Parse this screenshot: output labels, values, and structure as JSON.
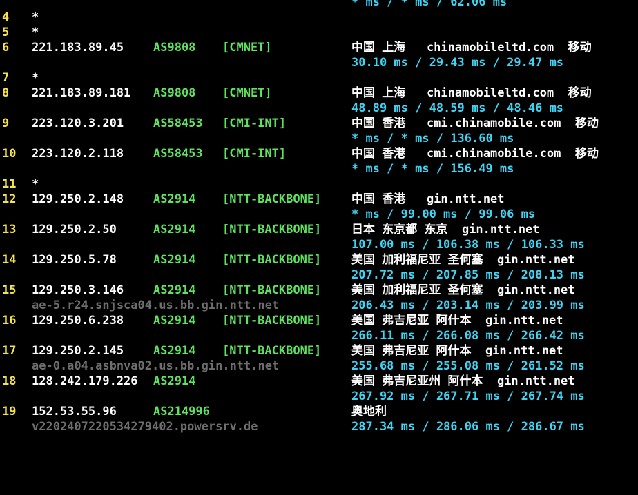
{
  "theme": {
    "background": "#000000",
    "hop_color": "#f4e34a",
    "ip_color": "#ffffff",
    "asn_color": "#5ee35e",
    "latency_color": "#3fd4f4",
    "rdns_color": "#6e6e6e"
  },
  "lines": [
    {
      "rtt": "* ms / * ms / 62.06 ms"
    },
    {
      "hop": "4",
      "star": "*"
    },
    {
      "hop": "5",
      "star": "*"
    },
    {
      "hop": "6",
      "ip": "221.183.89.45",
      "asn": "AS9808",
      "tag": "[CMNET]",
      "geo": "中国 上海   chinamobileltd.com  移动"
    },
    {
      "rtt": "30.10 ms / 29.43 ms / 29.47 ms"
    },
    {
      "hop": "7",
      "star": "*"
    },
    {
      "hop": "8",
      "ip": "221.183.89.181",
      "asn": "AS9808",
      "tag": "[CMNET]",
      "geo": "中国 上海   chinamobileltd.com  移动"
    },
    {
      "rtt": "48.89 ms / 48.59 ms / 48.46 ms"
    },
    {
      "hop": "9",
      "ip": "223.120.3.201",
      "asn": "AS58453",
      "tag": "[CMI-INT]",
      "geo": "中国 香港   cmi.chinamobile.com  移动"
    },
    {
      "rtt": "* ms / * ms / 136.60 ms"
    },
    {
      "hop": "10",
      "ip": "223.120.2.118",
      "asn": "AS58453",
      "tag": "[CMI-INT]",
      "geo": "中国 香港   cmi.chinamobile.com  移动"
    },
    {
      "rtt": "* ms / * ms / 156.49 ms"
    },
    {
      "hop": "11",
      "star": "*"
    },
    {
      "hop": "12",
      "ip": "129.250.2.148",
      "asn": "AS2914",
      "tag": "[NTT-BACKBONE]",
      "geo": "中国 香港   gin.ntt.net"
    },
    {
      "rtt": "* ms / 99.00 ms / 99.06 ms"
    },
    {
      "hop": "13",
      "ip": "129.250.2.50",
      "asn": "AS2914",
      "tag": "[NTT-BACKBONE]",
      "geo": "日本 东京都 东京  gin.ntt.net"
    },
    {
      "rtt": "107.00 ms / 106.38 ms / 106.33 ms"
    },
    {
      "hop": "14",
      "ip": "129.250.5.78",
      "asn": "AS2914",
      "tag": "[NTT-BACKBONE]",
      "geo": "美国 加利福尼亚 圣何塞  gin.ntt.net"
    },
    {
      "rtt": "207.72 ms / 207.85 ms / 208.13 ms"
    },
    {
      "hop": "15",
      "ip": "129.250.3.146",
      "asn": "AS2914",
      "tag": "[NTT-BACKBONE]",
      "geo": "美国 加利福尼亚 圣何塞  gin.ntt.net"
    },
    {
      "rdns": "ae-5.r24.snjsca04.us.bb.gin.ntt.net",
      "rtt": "206.43 ms / 203.14 ms / 203.99 ms"
    },
    {
      "hop": "16",
      "ip": "129.250.6.238",
      "asn": "AS2914",
      "tag": "[NTT-BACKBONE]",
      "geo": "美国 弗吉尼亚 阿什本  gin.ntt.net"
    },
    {
      "rtt": "266.11 ms / 266.08 ms / 266.42 ms"
    },
    {
      "hop": "17",
      "ip": "129.250.2.145",
      "asn": "AS2914",
      "tag": "[NTT-BACKBONE]",
      "geo": "美国 弗吉尼亚 阿什本  gin.ntt.net"
    },
    {
      "rdns": "ae-0.a04.asbnva02.us.bb.gin.ntt.net",
      "rtt": "255.68 ms / 255.08 ms / 261.52 ms"
    },
    {
      "hop": "18",
      "ip": "128.242.179.226",
      "asn": "AS2914",
      "geo": "美国 弗吉尼亚州 阿什本  gin.ntt.net"
    },
    {
      "rtt": "267.92 ms / 267.71 ms / 267.74 ms"
    },
    {
      "hop": "19",
      "ip": "152.53.55.96",
      "asn": "AS214996",
      "geo": "奥地利"
    },
    {
      "rdns": "v2202407220534279402.powersrv.de",
      "rtt": "287.34 ms / 286.06 ms / 286.67 ms"
    }
  ]
}
